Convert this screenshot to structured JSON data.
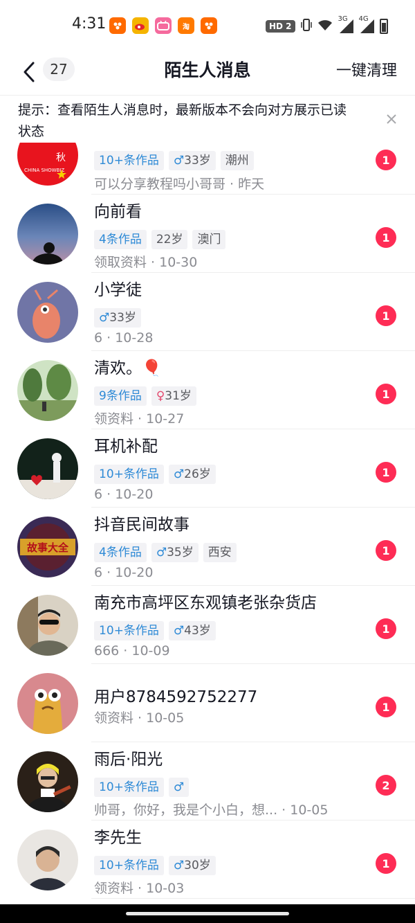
{
  "status_bar": {
    "time": "4:31",
    "apps": [
      {
        "icon": "app-icon-orange-a",
        "label": "",
        "color": "#ff6a00"
      },
      {
        "icon": "weibo-icon",
        "label": "",
        "color": "#f5b400"
      },
      {
        "icon": "bilibili-icon",
        "label": "",
        "color": "#f56a9d"
      },
      {
        "icon": "taobao-icon",
        "label": "淘",
        "color": "#ff7a00"
      },
      {
        "icon": "app-icon-orange-b",
        "label": "",
        "color": "#ff6a00"
      }
    ],
    "hd_label": "HD 2",
    "network_3g": "3G",
    "network_4g": "4G"
  },
  "nav": {
    "unread_count": "27",
    "title": "陌生人消息",
    "clear_label": "一键清理"
  },
  "tip": {
    "text": "提示：查看陌生人消息时，最新版本不会向对方展示已读状态"
  },
  "conversations": [
    {
      "name": "",
      "tags": [
        {
          "text": "10+条作品",
          "style": "blue"
        },
        {
          "gender": "male",
          "text": "33岁"
        },
        {
          "text": "潮州"
        }
      ],
      "preview": "可以分享教程吗小哥哥 · 昨天",
      "unread": "1",
      "avatar": "avatar-china-showbiz",
      "avatar_text": "CHINA SHOWBIZ"
    },
    {
      "name": "向前看",
      "tags": [
        {
          "text": "4条作品",
          "style": "blue"
        },
        {
          "text": "22岁"
        },
        {
          "text": "澳门"
        }
      ],
      "preview": "领取资料 · 10-30",
      "unread": "1",
      "avatar": "avatar-blue-sky"
    },
    {
      "name": "小学徒",
      "tags": [
        {
          "gender": "male",
          "text": "33岁"
        }
      ],
      "preview": "6 · 10-28",
      "unread": "1",
      "avatar": "avatar-cartoon-shrimp"
    },
    {
      "name": "清欢。🎈",
      "tags": [
        {
          "text": "9条作品",
          "style": "blue"
        },
        {
          "gender": "female",
          "text": "31岁"
        }
      ],
      "preview": "领资料 · 10-27",
      "unread": "1",
      "avatar": "avatar-forest"
    },
    {
      "name": "耳机补配",
      "tags": [
        {
          "text": "10+条作品",
          "style": "blue"
        },
        {
          "gender": "male",
          "text": "26岁"
        }
      ],
      "preview": "6 · 10-20",
      "unread": "1",
      "avatar": "avatar-heart-figure"
    },
    {
      "name": "抖音民间故事",
      "tags": [
        {
          "text": "4条作品",
          "style": "blue"
        },
        {
          "gender": "male",
          "text": "35岁"
        },
        {
          "text": "西安"
        }
      ],
      "preview": "6 · 10-20",
      "unread": "1",
      "avatar": "avatar-story-logo",
      "avatar_text": "故事大全"
    },
    {
      "name": "南充市高坪区东观镇老张杂货店",
      "tags": [
        {
          "text": "10+条作品",
          "style": "blue"
        },
        {
          "gender": "male",
          "text": "43岁"
        }
      ],
      "preview": "666 · 10-09",
      "unread": "1",
      "avatar": "avatar-man-sunglasses"
    },
    {
      "name": "用户8784592752277",
      "tags": [],
      "preview": "领资料 · 10-05",
      "unread": "1",
      "avatar": "avatar-cartoon-creature"
    },
    {
      "name": "雨后·阳光",
      "tags": [
        {
          "text": "10+条作品",
          "style": "blue"
        },
        {
          "gender": "male",
          "text": ""
        }
      ],
      "preview": "帅哥，你好，我是个小白，想... · 10-05",
      "unread": "2",
      "avatar": "avatar-guitar-player"
    },
    {
      "name": "李先生",
      "tags": [
        {
          "text": "10+条作品",
          "style": "blue"
        },
        {
          "gender": "male",
          "text": "30岁"
        }
      ],
      "preview": "领资料 · 10-03",
      "unread": "1",
      "avatar": "avatar-man-portrait"
    }
  ],
  "colors": {
    "badge": "#fe2c55",
    "tag_blue": "#2e8ad6",
    "male": "#2e8ad6",
    "female": "#e34a6f"
  }
}
